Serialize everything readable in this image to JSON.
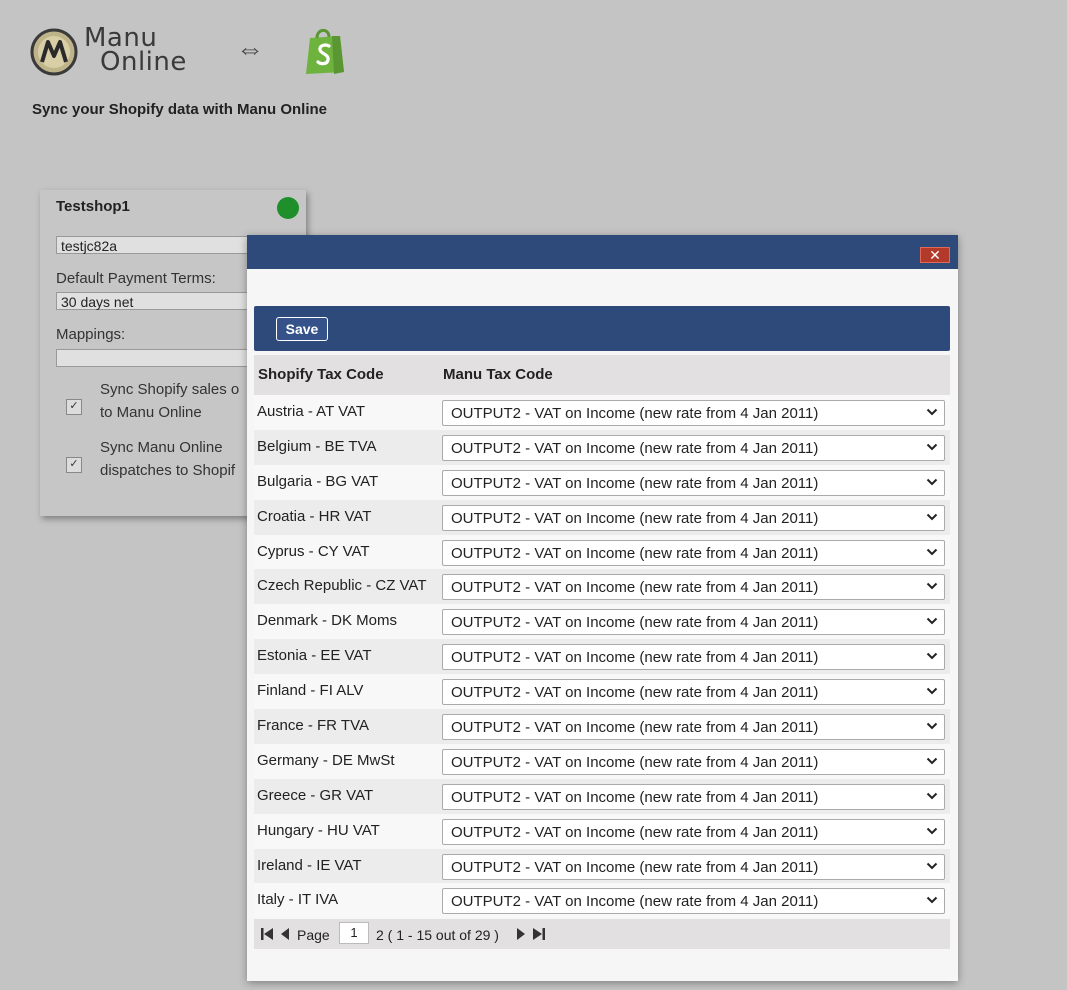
{
  "header": {
    "brand_line1": "Manu",
    "brand_line2": "Online",
    "sync_symbol": "⇔",
    "subtitle": "Sync your Shopify data with Manu Online"
  },
  "card": {
    "title": "Testshop1",
    "status_color": "#1e8f2a",
    "shop_id": "testjc82a",
    "payment_terms_label": "Default Payment Terms:",
    "payment_terms_value": "30 days net",
    "mappings_label": "Mappings:",
    "mappings_value": "",
    "sync_sales_line1": "Sync Shopify sales o",
    "sync_sales_line2": "to Manu Online",
    "sync_sales_checked": true,
    "sync_dispatch_line1": "Sync Manu Online",
    "sync_dispatch_line2": "dispatches to Shopif",
    "sync_dispatch_checked": true
  },
  "modal": {
    "close_label": "✕",
    "save_label": "Save",
    "col_shopify": "Shopify Tax Code",
    "col_manu": "Manu Tax Code",
    "rows": [
      {
        "name": "Austria - AT VAT",
        "value": "OUTPUT2 - VAT on Income (new rate from 4 Jan 2011)"
      },
      {
        "name": "Belgium - BE TVA",
        "value": "OUTPUT2 - VAT on Income (new rate from 4 Jan 2011)"
      },
      {
        "name": "Bulgaria - BG VAT",
        "value": "OUTPUT2 - VAT on Income (new rate from 4 Jan 2011)"
      },
      {
        "name": "Croatia - HR VAT",
        "value": "OUTPUT2 - VAT on Income (new rate from 4 Jan 2011)"
      },
      {
        "name": "Cyprus - CY VAT",
        "value": "OUTPUT2 - VAT on Income (new rate from 4 Jan 2011)"
      },
      {
        "name": "Czech Republic - CZ VAT",
        "value": "OUTPUT2 - VAT on Income (new rate from 4 Jan 2011)"
      },
      {
        "name": "Denmark - DK Moms",
        "value": "OUTPUT2 - VAT on Income (new rate from 4 Jan 2011)"
      },
      {
        "name": "Estonia - EE VAT",
        "value": "OUTPUT2 - VAT on Income (new rate from 4 Jan 2011)"
      },
      {
        "name": "Finland - FI ALV",
        "value": "OUTPUT2 - VAT on Income (new rate from 4 Jan 2011)"
      },
      {
        "name": "France - FR TVA",
        "value": "OUTPUT2 - VAT on Income (new rate from 4 Jan 2011)"
      },
      {
        "name": "Germany - DE MwSt",
        "value": "OUTPUT2 - VAT on Income (new rate from 4 Jan 2011)"
      },
      {
        "name": "Greece - GR VAT",
        "value": "OUTPUT2 - VAT on Income (new rate from 4 Jan 2011)"
      },
      {
        "name": "Hungary - HU VAT",
        "value": "OUTPUT2 - VAT on Income (new rate from 4 Jan 2011)"
      },
      {
        "name": "Ireland - IE VAT",
        "value": "OUTPUT2 - VAT on Income (new rate from 4 Jan 2011)"
      },
      {
        "name": "Italy - IT IVA",
        "value": "OUTPUT2 - VAT on Income (new rate from 4 Jan 2011)"
      }
    ],
    "pager": {
      "page_label": "Page",
      "current_page": "1",
      "summary": "2 ( 1 - 15 out of 29 )"
    }
  },
  "colors": {
    "header_blue": "#2e4a7a",
    "page_bg": "#c4c4c4",
    "status_green": "#1e8f2a"
  }
}
